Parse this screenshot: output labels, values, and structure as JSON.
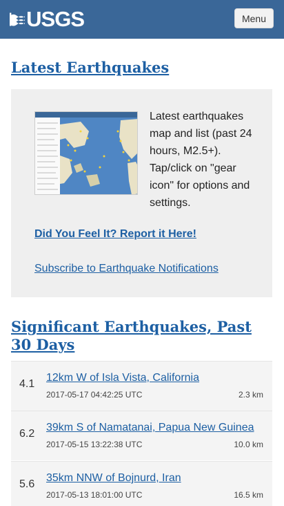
{
  "header": {
    "logo_text": "USGS",
    "menu_label": "Menu"
  },
  "latest": {
    "title": "Latest Earthquakes",
    "description": "Latest earthquakes map and list (past 24 hours, M2.5+). Tap/click on \"gear icon\" for options and settings.",
    "dyfi_link": "Did You Feel It? Report it Here!",
    "subscribe_link": "Subscribe to Earthquake Notifications"
  },
  "significant": {
    "title": "Significant Earthquakes, Past 30 Days",
    "rows": [
      {
        "magnitude": "4.1",
        "place": "12km W of Isla Vista, California",
        "time": "2017-05-17 04:42:25 UTC",
        "depth": "2.3 km"
      },
      {
        "magnitude": "6.2",
        "place": "39km S of Namatanai, Papua New Guinea",
        "time": "2017-05-15 13:22:38 UTC",
        "depth": "10.0 km"
      },
      {
        "magnitude": "5.6",
        "place": "35km NNW of Bojnurd, Iran",
        "time": "2017-05-13 18:01:00 UTC",
        "depth": "16.5 km"
      }
    ]
  },
  "colors": {
    "header_bg": "#3a6798",
    "link": "#1d5fa3",
    "card_bg": "#efefef"
  }
}
